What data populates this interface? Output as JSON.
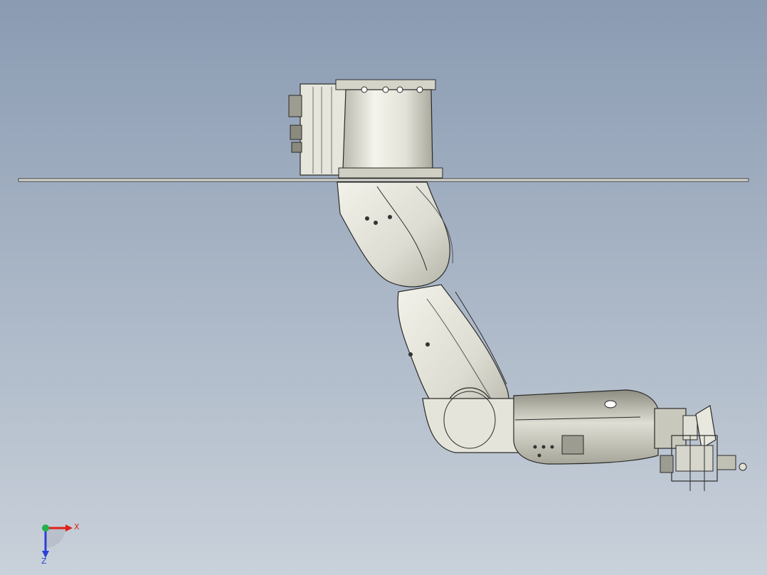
{
  "viewport": {
    "background_top": "#8a9bb2",
    "background_bottom": "#c9d1da"
  },
  "model": {
    "body_color": "#ecece4",
    "shade_color": "#c9c9bd",
    "dark_color": "#6f6f68",
    "edge_color": "#2a2a2a"
  },
  "triad": {
    "x_label": "X",
    "z_label": "Z",
    "x_color": "#e0201b",
    "z_color": "#2a3fd6",
    "y_color": "#22b14c",
    "x_icon": "x-axis-arrow",
    "z_icon": "z-axis-arrow",
    "y_icon": "y-axis-dot"
  }
}
